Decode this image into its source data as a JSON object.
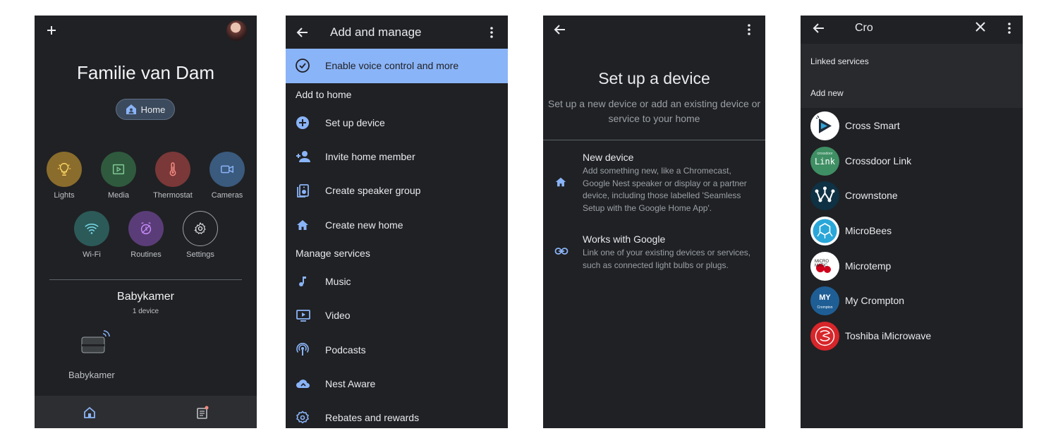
{
  "panel1": {
    "home_title": "Familie van Dam",
    "home_chip": "Home",
    "categories": [
      {
        "label": "Lights",
        "icon": "lightbulb-icon",
        "color": "#8a6d2c"
      },
      {
        "label": "Media",
        "icon": "media-icon",
        "color": "#2f5a3e"
      },
      {
        "label": "Thermostat",
        "icon": "thermostat-icon",
        "color": "#7a3838"
      },
      {
        "label": "Cameras",
        "icon": "camera-icon",
        "color": "#3a5a7e"
      },
      {
        "label": "Wi-Fi",
        "icon": "wifi-icon",
        "color": "#2c5a58"
      },
      {
        "label": "Routines",
        "icon": "routines-icon",
        "color": "#5a3d78"
      },
      {
        "label": "Settings",
        "icon": "gear-icon",
        "color": "#202124"
      }
    ],
    "room_name": "Babykamer",
    "room_count": "1 device",
    "device_name": "Babykamer"
  },
  "panel2": {
    "title": "Add and manage",
    "banner": "Enable voice control and more",
    "section_add": "Add to home",
    "add_items": [
      "Set up device",
      "Invite home member",
      "Create speaker group",
      "Create new home"
    ],
    "section_manage": "Manage services",
    "manage_items": [
      "Music",
      "Video",
      "Podcasts",
      "Nest Aware",
      "Rebates and rewards"
    ]
  },
  "panel3": {
    "title": "Set up a device",
    "subtitle": "Set up a new device or add an existing device or service to your home",
    "options": [
      {
        "title": "New device",
        "desc": "Add something new, like a Chromecast, Google Nest speaker or display or a partner device, including those labelled 'Seamless Setup with the Google Home App'."
      },
      {
        "title": "Works with Google",
        "desc": "Link one of your existing devices or services, such as connected light bulbs or plugs."
      }
    ]
  },
  "panel4": {
    "query": "Cro",
    "linked_label": "Linked services",
    "add_new_label": "Add new",
    "services": [
      "Cross Smart",
      "Crossdoor Link",
      "Crownstone",
      "MicroBees",
      "Microtemp",
      "My Crompton",
      "Toshiba iMicrowave"
    ],
    "logo_texts": {
      "crossdoor": "Link",
      "crossdoor_small": "crossdoor",
      "microtemp": "MICRO MATIC",
      "mycrompton": "MY",
      "mycrompton_small": "Crompton"
    }
  },
  "colors": {
    "background": "#202124",
    "accent": "#8ab4f8",
    "icon_blue": "#8ab4f8"
  }
}
